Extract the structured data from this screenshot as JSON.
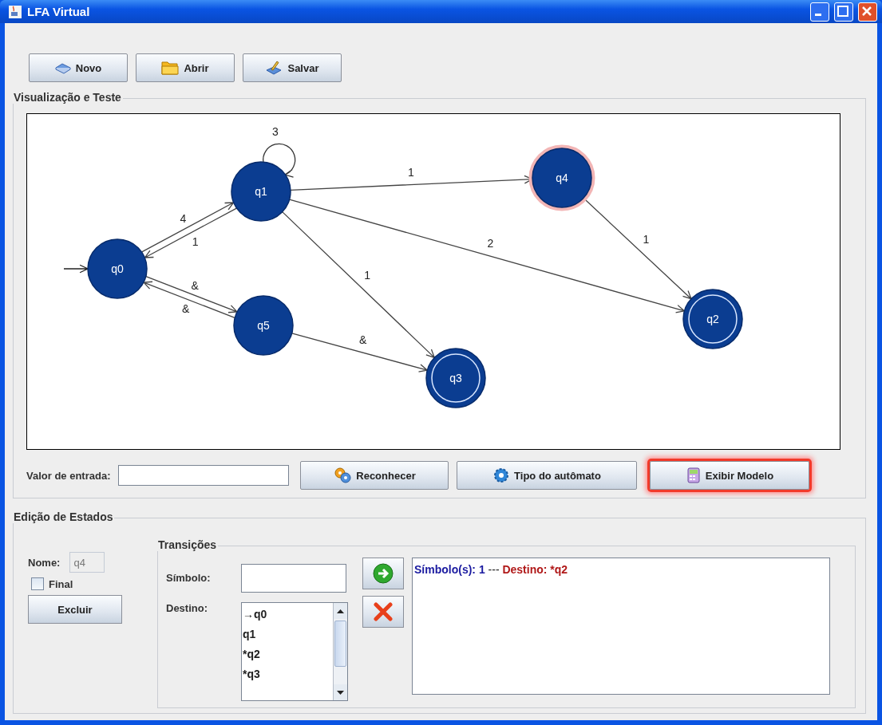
{
  "window": {
    "title": "LFA Virtual"
  },
  "toolbar": [
    {
      "label": "Novo",
      "kind": "new"
    },
    {
      "label": "Abrir",
      "kind": "open"
    },
    {
      "label": "Salvar",
      "kind": "save"
    }
  ],
  "visualization": {
    "title": "Visualização e Teste",
    "automaton": {
      "states": [
        {
          "name": "q0",
          "initial": true,
          "final": false,
          "selected": false
        },
        {
          "name": "q1",
          "initial": false,
          "final": false,
          "selected": false
        },
        {
          "name": "q2",
          "initial": false,
          "final": true,
          "selected": false
        },
        {
          "name": "q3",
          "initial": false,
          "final": true,
          "selected": false
        },
        {
          "name": "q4",
          "initial": false,
          "final": false,
          "selected": true
        },
        {
          "name": "q5",
          "initial": false,
          "final": false,
          "selected": false
        }
      ],
      "transitions": [
        {
          "label": "4"
        },
        {
          "label": "1"
        },
        {
          "label": "3"
        },
        {
          "label": "1"
        },
        {
          "label": "2"
        },
        {
          "label": "1"
        },
        {
          "label": "&"
        },
        {
          "label": "&"
        },
        {
          "label": "&"
        },
        {
          "label": "1"
        }
      ]
    },
    "input_label": "Valor de entrada:",
    "buttons": [
      {
        "label": "Reconhecer",
        "kind": "recognize",
        "highlighted": false
      },
      {
        "label": "Tipo do autômato",
        "kind": "type",
        "highlighted": false
      },
      {
        "label": "Exibir Modelo",
        "kind": "model",
        "highlighted": true
      }
    ]
  },
  "state_editing": {
    "title": "Edição de Estados",
    "name_label": "Nome:",
    "name_value": "q4",
    "final": {
      "label": "Final",
      "checked": false
    },
    "delete_button": "Excluir",
    "transitions": {
      "title": "Transições",
      "symbol_label": "Símbolo:",
      "destination_label": "Destino:",
      "destinations": [
        "→q0",
        "q1",
        "*q2",
        "*q3"
      ],
      "entries": [
        {
          "parts": [
            {
              "text": "Símbolo(s): 1",
              "kind": "symbol"
            },
            {
              "text": " --- ",
              "kind": "separator"
            },
            {
              "text": "Destino: *q2",
              "kind": "destination"
            }
          ]
        }
      ]
    }
  }
}
